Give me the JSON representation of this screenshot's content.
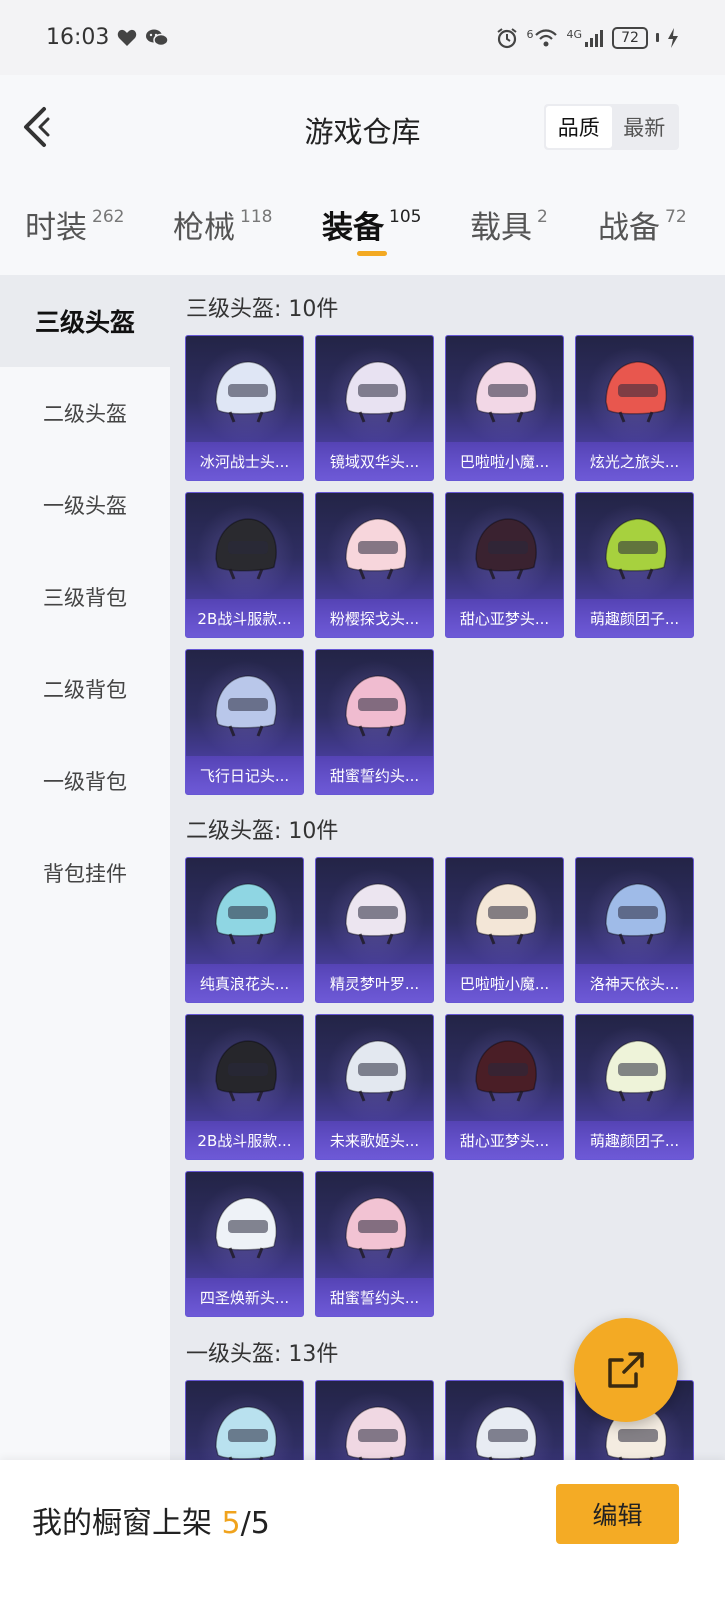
{
  "status_bar": {
    "time": "16:03",
    "network_label": "4G",
    "sim_label": "6",
    "battery": "72"
  },
  "header": {
    "title": "游戏仓库",
    "sort_options": [
      "品质",
      "最新"
    ],
    "active_sort": "品质"
  },
  "tabs": [
    {
      "label": "时装",
      "count": "262"
    },
    {
      "label": "枪械",
      "count": "118"
    },
    {
      "label": "装备",
      "count": "105",
      "active": true
    },
    {
      "label": "载具",
      "count": "2"
    },
    {
      "label": "战备",
      "count": "72"
    }
  ],
  "sidebar": {
    "items": [
      "三级头盔",
      "二级头盔",
      "一级头盔",
      "三级背包",
      "二级背包",
      "一级背包",
      "背包挂件"
    ],
    "active": "三级头盔"
  },
  "sections": [
    {
      "title": "三级头盔: 10件",
      "items": [
        {
          "label": "冰河战士头...",
          "color": "#dfe6f5"
        },
        {
          "label": "镜域双华头...",
          "color": "#e8e2f2"
        },
        {
          "label": "巴啦啦小魔...",
          "color": "#f2d7e6"
        },
        {
          "label": "炫光之旅头...",
          "color": "#e8574e"
        },
        {
          "label": "2B战斗服款...",
          "color": "#2a2a2f"
        },
        {
          "label": "粉樱探戈头...",
          "color": "#f7d6dc"
        },
        {
          "label": "甜心亚梦头...",
          "color": "#3a2230"
        },
        {
          "label": "萌趣颜团子...",
          "color": "#a7d13e"
        },
        {
          "label": "飞行日记头...",
          "color": "#b9c7ea"
        },
        {
          "label": "甜蜜誓约头...",
          "color": "#f0bcd0"
        }
      ]
    },
    {
      "title": "二级头盔: 10件",
      "items": [
        {
          "label": "纯真浪花头...",
          "color": "#8fd6e3"
        },
        {
          "label": "精灵梦叶罗...",
          "color": "#ece5f0"
        },
        {
          "label": "巴啦啦小魔...",
          "color": "#f3e6d7"
        },
        {
          "label": "洛神天依头...",
          "color": "#9fbbe8"
        },
        {
          "label": "2B战斗服款...",
          "color": "#26262b"
        },
        {
          "label": "未来歌姬头...",
          "color": "#e3e8f0"
        },
        {
          "label": "甜心亚梦头...",
          "color": "#4a1e26"
        },
        {
          "label": "萌趣颜团子...",
          "color": "#eef3d9"
        },
        {
          "label": "四圣焕新头...",
          "color": "#eef2f7"
        },
        {
          "label": "甜蜜誓约头...",
          "color": "#f2c3d3"
        }
      ]
    },
    {
      "title": "一级头盔: 13件",
      "items": [
        {
          "label": "",
          "color": "#b9e1ef"
        },
        {
          "label": "",
          "color": "#f0d8e3"
        },
        {
          "label": "",
          "color": "#e8ecf3"
        },
        {
          "label": "",
          "color": "#f4ece1"
        }
      ]
    }
  ],
  "bottom_bar": {
    "text": "我的橱窗上架 ",
    "count": "5",
    "total": "/5",
    "edit_label": "编辑"
  }
}
